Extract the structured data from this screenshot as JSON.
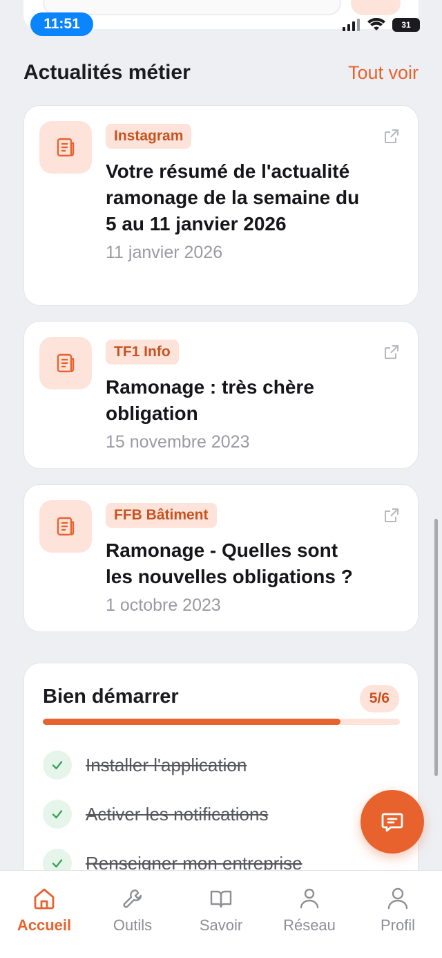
{
  "status_bar": {
    "time": "11:51",
    "battery": "31"
  },
  "section": {
    "title": "Actualités métier",
    "see_all": "Tout voir"
  },
  "news": [
    {
      "source": "Instagram",
      "title": "Votre résumé de l'actualité ramonage de la semaine du 5 au 11 janvier 2026",
      "date": "11 janvier 2026"
    },
    {
      "source": "TF1 Info",
      "title": "Ramonage : très chère obligation",
      "date": "15 novembre 2023"
    },
    {
      "source": "FFB Bâtiment",
      "title": "Ramonage - Quelles sont les nouvelles obligations ?",
      "date": "1 octobre 2023"
    }
  ],
  "onboarding": {
    "title": "Bien démarrer",
    "progress_label": "5/6",
    "progress_fraction": 0.833,
    "tasks": [
      {
        "label": "Installer l'application",
        "done": true
      },
      {
        "label": "Activer les notifications",
        "done": true
      },
      {
        "label": "Renseigner mon entreprise",
        "done": true
      }
    ]
  },
  "bottom_nav": [
    {
      "label": "Accueil",
      "icon": "home-icon",
      "active": true
    },
    {
      "label": "Outils",
      "icon": "wrench-icon",
      "active": false
    },
    {
      "label": "Savoir",
      "icon": "book-icon",
      "active": false
    },
    {
      "label": "Réseau",
      "icon": "user-icon",
      "active": false
    },
    {
      "label": "Profil",
      "icon": "user-icon",
      "active": false
    }
  ],
  "colors": {
    "accent": "#e8622d",
    "accent_soft": "#fde3da",
    "check": "#3aa35a"
  }
}
